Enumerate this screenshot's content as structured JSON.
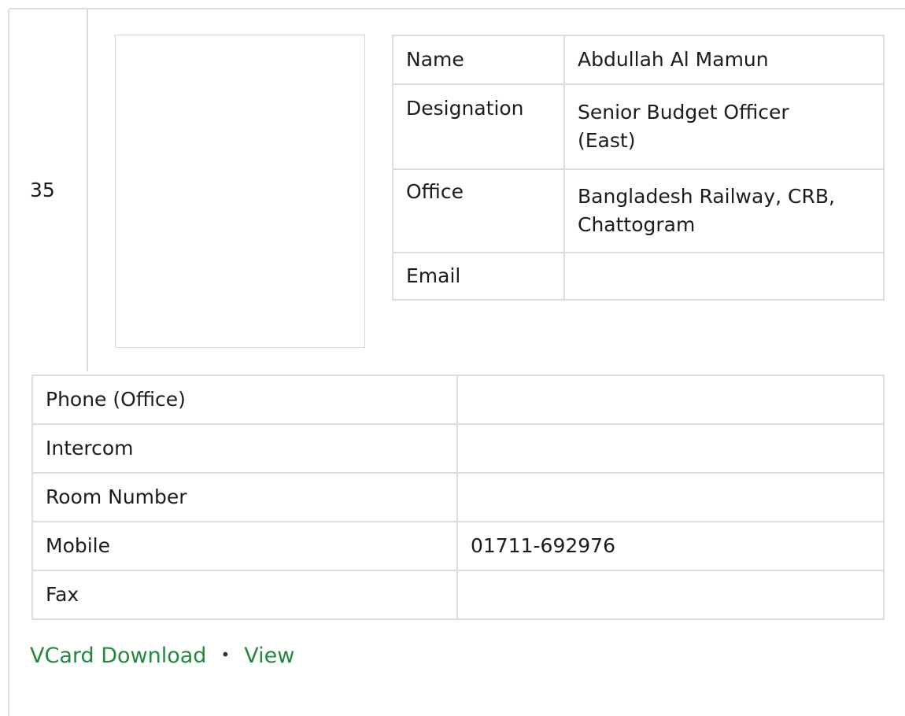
{
  "serial": "35",
  "info": [
    {
      "label": "Name",
      "value": "Abdullah Al Mamun"
    },
    {
      "label": "Designation",
      "value": "Senior Budget Officer (East)"
    },
    {
      "label": "Office",
      "value": "Bangladesh Railway, CRB, Chattogram"
    },
    {
      "label": "Email",
      "value": ""
    }
  ],
  "contact": [
    {
      "label": "Phone (Office)",
      "value": ""
    },
    {
      "label": "Intercom",
      "value": ""
    },
    {
      "label": "Room Number",
      "value": ""
    },
    {
      "label": "Mobile",
      "value": "01711-692976"
    },
    {
      "label": "Fax",
      "value": ""
    }
  ],
  "links": {
    "vcard": "VCard Download",
    "separator": "•",
    "view": "View",
    "link_color": "#1f8a3b"
  }
}
